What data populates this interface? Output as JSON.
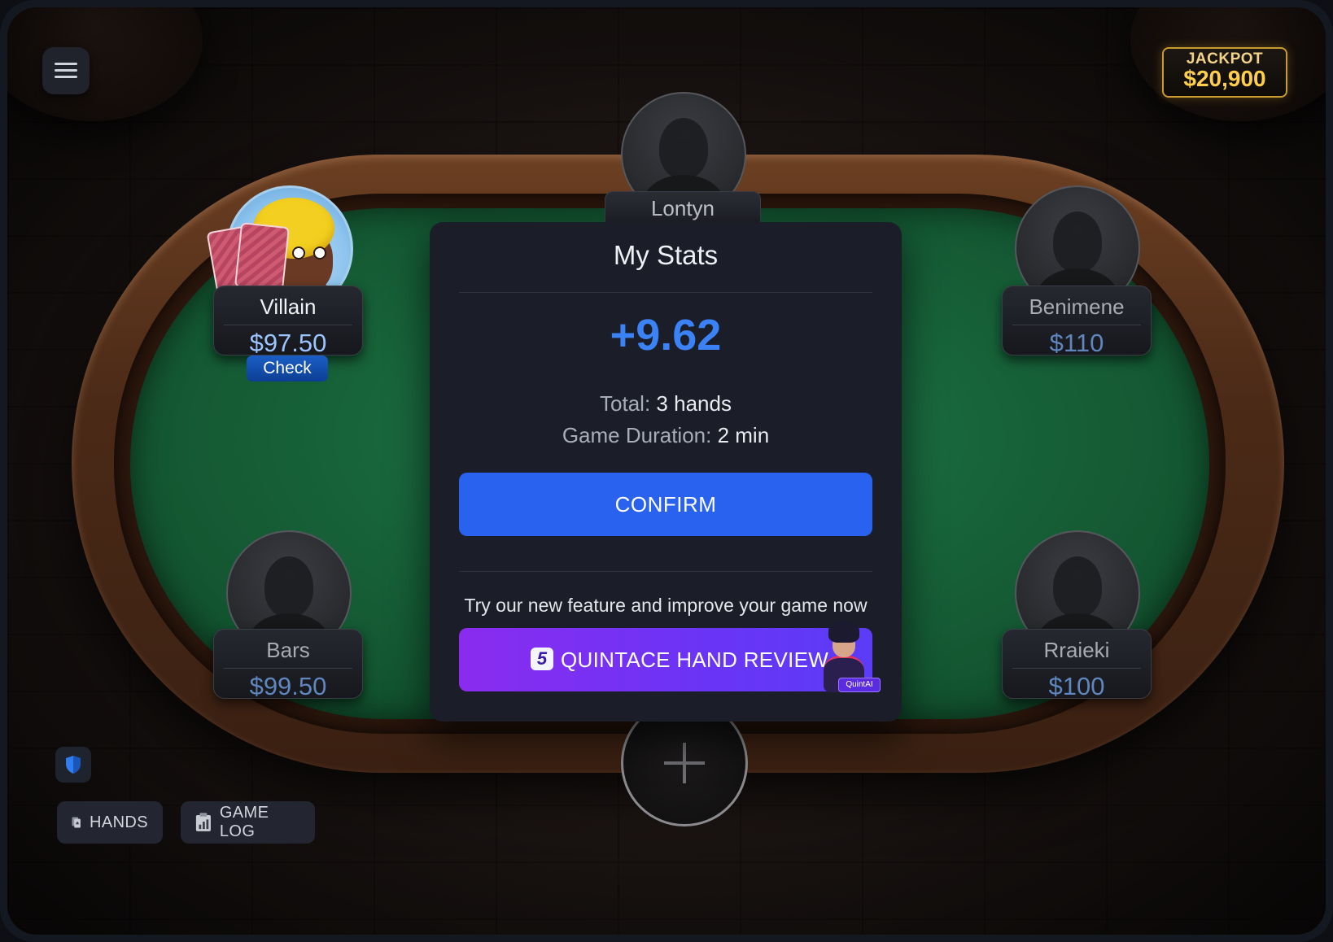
{
  "jackpot": {
    "label": "JACKPOT",
    "amount": "$20,900"
  },
  "seats": {
    "top": {
      "name": "Lontyn"
    },
    "left_top": {
      "name": "Villain",
      "stack": "$97.50",
      "action": "Check"
    },
    "right_top": {
      "name": "Benimene",
      "stack": "$110"
    },
    "left_bottom": {
      "name": "Bars",
      "stack": "$99.50"
    },
    "right_bottom": {
      "name": "Rraieki",
      "stack": "$100"
    }
  },
  "stats_modal": {
    "title": "My Stats",
    "result": "+9.62",
    "total_label": "Total:",
    "total_value": "3 hands",
    "duration_label": "Game Duration:",
    "duration_value": "2 min",
    "confirm_label": "CONFIRM",
    "promo_text": "Try our new feature and improve your game now",
    "review_logo": "5",
    "review_label": "QUINTACE HAND REVIEW",
    "review_tag": "QuintAI"
  },
  "bottom_bar": {
    "hands_label": "HANDS",
    "game_log_label": "GAME LOG"
  },
  "colors": {
    "accent": "#2962ee",
    "result": "#3b82f6",
    "felt": "#1a6b40",
    "jackpot_gold": "#ffcf4a",
    "review_purple": "#7a2ff2"
  },
  "icons": [
    "menu-icon",
    "shield-icon",
    "hands-icon",
    "game-log-icon",
    "plus-icon"
  ]
}
